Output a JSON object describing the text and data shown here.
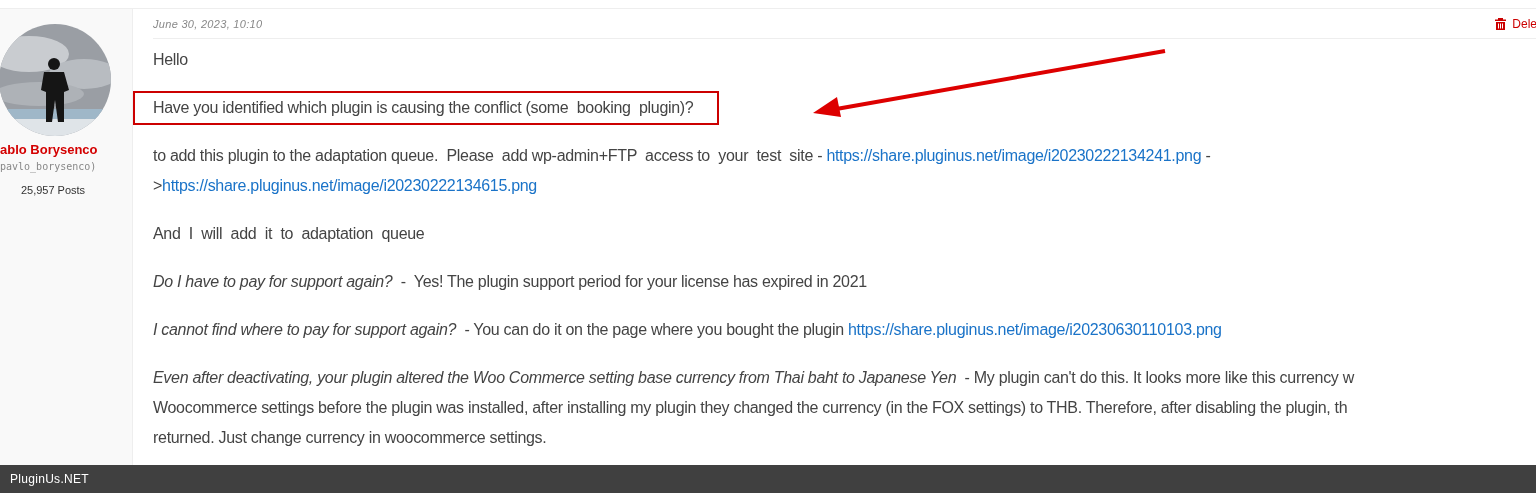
{
  "author": {
    "name": "ablo Borysenco",
    "handle": "pavlo_borysenco)",
    "posts": "25,957 Posts"
  },
  "post": {
    "date": "June 30, 2023, 10:10",
    "delete_label": "Dele",
    "paragraphs": [
      {
        "kind": "plain",
        "lines": [
          [
            {
              "text": "Hello"
            }
          ]
        ]
      },
      {
        "kind": "highlighted",
        "lines": [
          [
            {
              "text": "Have you identified which plugin is causing the conflict (some  booking  plugin)?"
            }
          ]
        ]
      },
      {
        "kind": "plain",
        "lines": [
          [
            {
              "text": "to add this plugin to the adaptation queue.  Please  add wp-admin+FTP  access to  your  test  site - "
            },
            {
              "text": "https://share.pluginus.net/image/i20230222134241.png",
              "link": true
            },
            {
              "text": " -"
            }
          ],
          [
            {
              "text": ">"
            },
            {
              "text": "https://share.pluginus.net/image/i20230222134615.png",
              "link": true
            }
          ]
        ]
      },
      {
        "kind": "plain",
        "lines": [
          [
            {
              "text": "And  I  will  add  it  to  adaptation  queue"
            }
          ]
        ]
      },
      {
        "kind": "plain",
        "lines": [
          [
            {
              "text": "Do I have to pay for support again?",
              "italic": true
            },
            {
              "text": "  -  Yes! The plugin support period for your license has expired in 2021"
            }
          ]
        ]
      },
      {
        "kind": "plain",
        "lines": [
          [
            {
              "text": "I cannot find where to pay for support again?",
              "italic": true
            },
            {
              "text": "  - You can do it on the page where you bought the plugin "
            },
            {
              "text": "https://share.pluginus.net/image/i20230630110103.png",
              "link": true
            }
          ]
        ]
      },
      {
        "kind": "plain",
        "lines": [
          [
            {
              "text": "Even after deactivating, your plugin altered the Woo Commerce setting base currency from Thai baht to Japanese Yen",
              "italic": true
            },
            {
              "text": "  - My plugin can't do this. It looks more like this currency w"
            }
          ],
          [
            {
              "text": "Woocommerce settings before the plugin was installed, after installing my plugin they changed the currency (in the FOX settings) to THB. Therefore, after disabling the plugin, th"
            }
          ],
          [
            {
              "text": "returned. Just change currency in woocommerce settings."
            }
          ]
        ]
      }
    ]
  },
  "footer": {
    "brand": "PluginUs.NET"
  }
}
